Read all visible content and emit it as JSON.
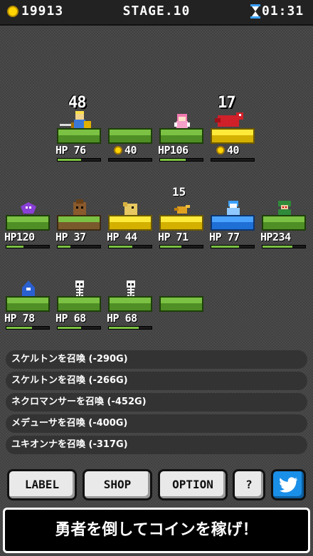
{
  "header": {
    "coins": "19913",
    "stage": "STAGE.10",
    "timer": "01:31"
  },
  "row1": [
    {
      "stat": "HP 76",
      "hp": 0.55,
      "block": "green",
      "char": "hero-icon",
      "bignum": "48"
    },
    {
      "stat": "40",
      "coin": true,
      "hp": 0,
      "block": "green",
      "char": "",
      "bignum": ""
    },
    {
      "stat": "HP106",
      "hp": 0.6,
      "block": "green",
      "char": "pink-fairy-icon",
      "bignum": ""
    },
    {
      "stat": "40",
      "coin": true,
      "hp": 0,
      "block": "gold",
      "char": "red-dragon-icon",
      "bignum": "17"
    }
  ],
  "row2": [
    {
      "stat": "HP120",
      "hp": 0.4,
      "block": "green",
      "char": "purple-bat-icon",
      "num": ""
    },
    {
      "stat": "HP 37",
      "hp": 0.3,
      "block": "dirt",
      "char": "golem-icon",
      "num": ""
    },
    {
      "stat": "HP 44",
      "hp": 0.55,
      "block": "gold",
      "char": "beast-icon",
      "num": ""
    },
    {
      "stat": "HP 71",
      "hp": 0.5,
      "block": "gold",
      "char": "bird-icon",
      "num": "15"
    },
    {
      "stat": "HP 77",
      "hp": 0.65,
      "block": "blue",
      "char": "yuki-onna-icon",
      "num": ""
    },
    {
      "stat": "HP234",
      "hp": 0.7,
      "block": "green",
      "char": "medusa-icon",
      "num": ""
    }
  ],
  "row3": [
    {
      "stat": "HP 78",
      "hp": 0.6,
      "block": "green",
      "char": "necromancer-icon"
    },
    {
      "stat": "HP 68",
      "hp": 0.55,
      "block": "green",
      "char": "skeleton-icon"
    },
    {
      "stat": "HP 68",
      "hp": 0.7,
      "block": "green",
      "char": "skeleton-icon"
    },
    {
      "stat": "",
      "hp": -1,
      "block": "green",
      "char": ""
    }
  ],
  "log": [
    "スケルトンを召喚 (-290G)",
    "スケルトンを召喚 (-266G)",
    "ネクロマンサーを召喚 (-452G)",
    "メデューサを召喚 (-400G)",
    "ユキオンナを召喚 (-317G)"
  ],
  "buttons": {
    "label": "LABEL",
    "shop": "SHOP",
    "option": "OPTION",
    "help": "?"
  },
  "banner": "勇者を倒してコインを稼げ！",
  "colors": {
    "grass": "#7bc143",
    "gold": "#ffea3a",
    "blue": "#4aa3ff",
    "coin": "#ffd400"
  }
}
